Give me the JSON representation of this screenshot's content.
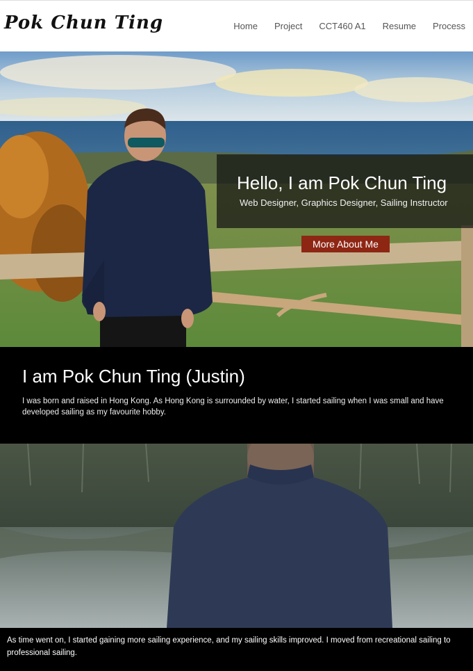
{
  "header": {
    "logo": "Pok Chun Ting",
    "nav": [
      "Home",
      "Project",
      "CCT460 A1",
      "Resume",
      "Process"
    ]
  },
  "hero": {
    "title": "Hello, I am Pok Chun Ting",
    "subtitle": "Web Designer, Graphics Designer, Sailing Instructor",
    "button": "More About Me"
  },
  "about": {
    "heading": "I am Pok Chun Ting (Justin)",
    "text": "I was born and raised in Hong Kong. As Hong Kong is surrounded by water, I started sailing when I was small and have developed sailing as my favourite hobby."
  },
  "caption": {
    "text": "As time went on, I started gaining more sailing experience, and my sailing skills improved. I moved from recreational sailing to professional sailing."
  },
  "colors": {
    "button_bg": "#8e2614",
    "dark_band": "#000000"
  }
}
